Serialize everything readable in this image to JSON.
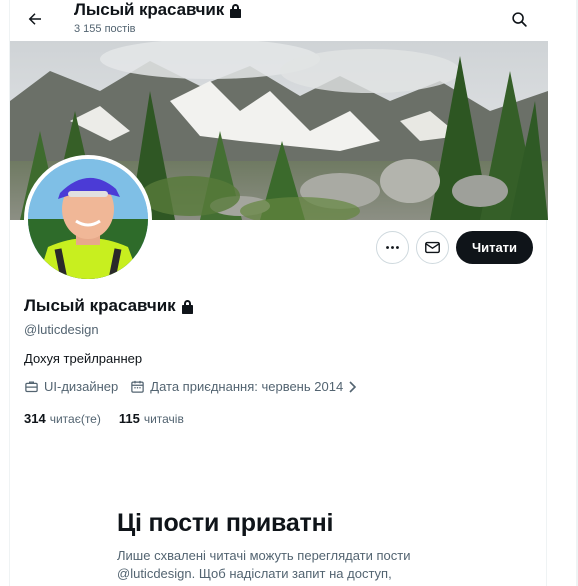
{
  "header": {
    "title": "Лысый красавчик",
    "posts_count": "3 155 постів"
  },
  "profile": {
    "name": "Лысый красавчик",
    "handle": "@luticdesign",
    "bio": "Дохуя трейлраннер",
    "profession": "UI-дизайнер",
    "joined": "Дата приєднання: червень 2014",
    "following_count": "314",
    "following_label": "читає(те)",
    "followers_count": "115",
    "followers_label": "читачів"
  },
  "actions": {
    "follow_label": "Читати"
  },
  "private_notice": {
    "title": "Ці пости приватні",
    "text": "Лише схвалені читачі можуть переглядати пости @luticdesign. Щоб надіслати запит на доступ,"
  },
  "icons": {
    "back": "arrow-left-icon",
    "search": "search-icon",
    "lock": "lock-icon",
    "more": "more-horizontal-icon",
    "message": "envelope-icon",
    "profession": "briefcase-icon",
    "calendar": "calendar-icon"
  },
  "colors": {
    "primary_text": "#0f1419",
    "secondary_text": "#536471",
    "follow_button_bg": "#0f1419",
    "border": "#cfd9de"
  }
}
